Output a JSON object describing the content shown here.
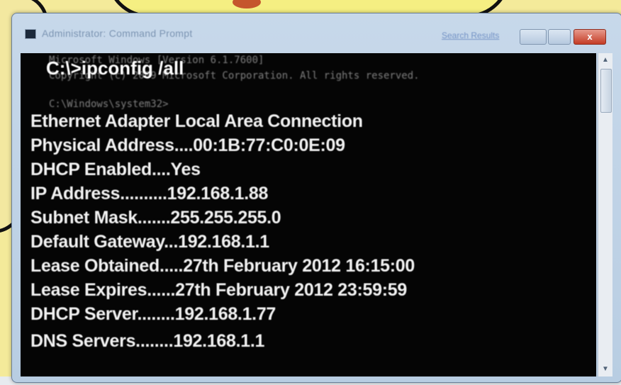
{
  "window": {
    "title": "Administrator: Command Prompt",
    "title_link": "Search Results"
  },
  "console": {
    "header_lines": [
      "Microsoft Windows [Version 6.1.7600]",
      "Copyright (c) 2009 Microsoft Corporation.  All rights reserved.",
      "C:\\Windows\\system32>"
    ],
    "command": "C:\\>ipconfig /all",
    "output": [
      "Ethernet Adapter Local Area Connection",
      "Physical Address....00:1B:77:C0:0E:09",
      "DHCP Enabled....Yes",
      "IP Address..........192.168.1.88",
      "Subnet Mask.......255.255.255.0",
      "Default Gateway...192.168.1.1",
      "Lease Obtained.....27th February 2012 16:15:00",
      "Lease Expires......27th February 2012 23:59:59",
      "DHCP Server........192.168.1.77",
      "DNS Servers........192.168.1.1"
    ]
  },
  "controls": {
    "close_label": "x"
  },
  "colors": {
    "console_bg": "#050505",
    "console_text": "#f2f2f2",
    "titlebar": "#c7d8ea",
    "close_button": "#c43c25"
  }
}
